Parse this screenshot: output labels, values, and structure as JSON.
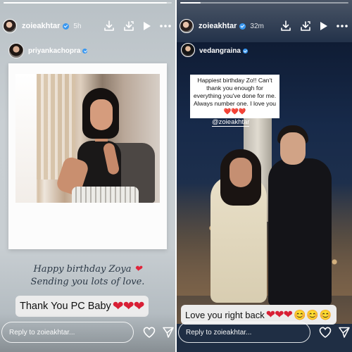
{
  "left_story": {
    "username": "zoieakhtar",
    "time": "5h",
    "progress": 0.97,
    "inner_username": "priyankachopra",
    "message_line1": "Happy birthday Zoya",
    "message_line2": "Sending you lots of love.",
    "reply_text": "Thank You PC Baby",
    "reply_emojis": "❤️❤️❤️",
    "reply_placeholder": "Reply to zoieakhtar..."
  },
  "right_story": {
    "username": "zoieakhtar",
    "time": "32m",
    "progress": 0.12,
    "inner_username": "vedangraina",
    "caption": "Happiest birthday Zo!! Can't thank you enough for everything you've done for me. Always number one. I love you❤️❤️❤️",
    "mention": "@zoieakhtar",
    "reply_text": "Love you right back",
    "reply_hearts": "❤️❤️❤️",
    "reply_emojis": "😊😊😊",
    "reply_placeholder": "Reply to zoieakhtar..."
  },
  "colors": {
    "verified": "#3897f0",
    "heart": "#d81f35",
    "left_bg": "#c6ccd0",
    "right_bg": "#1f2e44"
  },
  "icons": [
    "download-icon",
    "add-story-icon",
    "play-icon",
    "more-icon",
    "heart-icon",
    "send-icon",
    "verified-icon"
  ]
}
